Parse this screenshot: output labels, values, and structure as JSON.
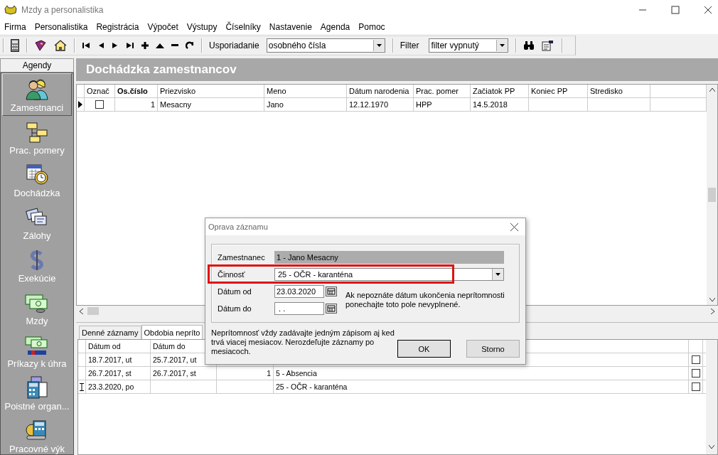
{
  "window": {
    "title": "Mzdy a personalistika"
  },
  "menu": [
    "Firma",
    "Personalistika",
    "Registrácia",
    "Výpočet",
    "Výstupy",
    "Číselníky",
    "Nastavenie",
    "Agenda",
    "Pomoc"
  ],
  "toolbar": {
    "sort_label": "Usporiadanie",
    "sort_value": "osobného čísla",
    "filter_label": "Filter",
    "filter_value": "filter vypnutý"
  },
  "sidebar": {
    "header": "Agendy",
    "items": [
      {
        "label": "Zamestnanci",
        "selected": true,
        "kind": "people"
      },
      {
        "label": "Prac. pomery",
        "selected": false,
        "kind": "chart"
      },
      {
        "label": "Dochádzka",
        "selected": false,
        "kind": "calendar"
      },
      {
        "label": "Zálohy",
        "selected": false,
        "kind": "cards"
      },
      {
        "label": "Exekúcie",
        "selected": false,
        "kind": "dollar"
      },
      {
        "label": "Mzdy",
        "selected": false,
        "kind": "money"
      },
      {
        "label": "Príkazy k úhra",
        "selected": false,
        "kind": "sepa"
      },
      {
        "label": "Poistné organ...",
        "selected": false,
        "kind": "office"
      },
      {
        "label": "Pracovné výk",
        "selected": false,
        "kind": "tools"
      }
    ]
  },
  "page_title": "Dochádzka zamestnancov",
  "employees": {
    "columns": [
      "Označ",
      "Os.číslo",
      "Priezvisko",
      "Meno",
      "Dátum narodenia",
      "Prac. pomer",
      "Začiatok PP",
      "Koniec PP",
      "Stredisko"
    ],
    "rows": [
      {
        "current": true,
        "checked": false,
        "cells": [
          "",
          "1",
          "Mesacny",
          "Jano",
          "12.12.1970",
          "HPP",
          "14.5.2018"
        ]
      }
    ]
  },
  "tabs": [
    {
      "label": "Denné záznamy",
      "selected": false
    },
    {
      "label": "Obdobia nepríto",
      "selected": true
    }
  ],
  "periods": {
    "columns": [
      "Dátum od",
      "Dátum do"
    ],
    "rows": [
      {
        "editing": false,
        "checked": false,
        "date_from": "18.7.2017, ut",
        "date_to": "25.7.2017, ut"
      },
      {
        "editing": false,
        "checked": false,
        "date_from": "26.7.2017, st",
        "date_to": "26.7.2017, st",
        "days": "1",
        "activity": "5 - Absencia"
      },
      {
        "editing": true,
        "checked": false,
        "date_from": "23.3.2020, po",
        "activity": "25 - OČR - karanténa"
      }
    ]
  },
  "dialog": {
    "title": "Oprava záznamu",
    "employee_label": "Zamestnanec",
    "employee_value": "1 - Jano Mesacny",
    "activity_label": "Činnosť",
    "activity_value": "25 - OČR - karanténa",
    "activity_highlighted": true,
    "from_label": "Dátum od",
    "from_value": "23.03.2020",
    "to_label": "Dátum do",
    "to_value": " . .",
    "hint": "Ak nepoznáte dátum ukončenia neprítomnosti ponechajte toto pole nevyplnené.",
    "note": "Neprítomnosť vždy zadávajte jedným zápisom aj ked trvá viacej mesiacov. Nerozdeľujte záznamy po mesiacoch.",
    "ok": "OK",
    "cancel": "Storno"
  }
}
